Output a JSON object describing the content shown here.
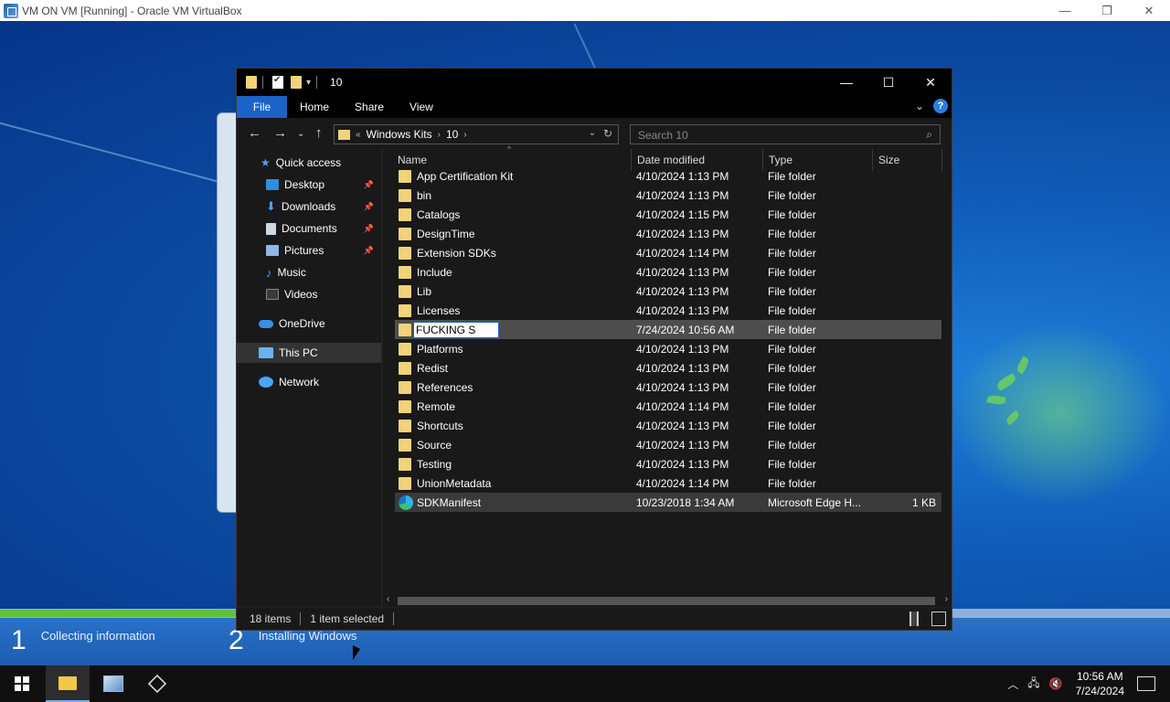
{
  "host": {
    "title": "VM ON VM [Running] - Oracle VM VirtualBox",
    "controls": [
      "—",
      "❐",
      "✕"
    ]
  },
  "setup": {
    "steps": [
      {
        "num": "1",
        "label": "Collecting information"
      },
      {
        "num": "2",
        "label": "Installing Windows"
      }
    ]
  },
  "explorer": {
    "title": "10",
    "controls": [
      "—",
      "☐",
      "✕"
    ],
    "ribbon": {
      "file": "File",
      "home": "Home",
      "share": "Share",
      "view": "View",
      "help": "?"
    },
    "address": {
      "prefix": "«",
      "crumbs": [
        "Windows Kits",
        "10"
      ]
    },
    "search_placeholder": "Search 10",
    "nav": {
      "quick_access": "Quick access",
      "desktop": "Desktop",
      "downloads": "Downloads",
      "documents": "Documents",
      "pictures": "Pictures",
      "music": "Music",
      "videos": "Videos",
      "onedrive": "OneDrive",
      "this_pc": "This PC",
      "network": "Network"
    },
    "columns": {
      "name": "Name",
      "date": "Date modified",
      "type": "Type",
      "size": "Size"
    },
    "rows": [
      {
        "name": "App Certification Kit",
        "date": "4/10/2024 1:13 PM",
        "type": "File folder",
        "size": ""
      },
      {
        "name": "bin",
        "date": "4/10/2024 1:13 PM",
        "type": "File folder",
        "size": ""
      },
      {
        "name": "Catalogs",
        "date": "4/10/2024 1:15 PM",
        "type": "File folder",
        "size": ""
      },
      {
        "name": "DesignTime",
        "date": "4/10/2024 1:13 PM",
        "type": "File folder",
        "size": ""
      },
      {
        "name": "Extension SDKs",
        "date": "4/10/2024 1:14 PM",
        "type": "File folder",
        "size": ""
      },
      {
        "name": "Include",
        "date": "4/10/2024 1:13 PM",
        "type": "File folder",
        "size": ""
      },
      {
        "name": "Lib",
        "date": "4/10/2024 1:13 PM",
        "type": "File folder",
        "size": ""
      },
      {
        "name": "Licenses",
        "date": "4/10/2024 1:13 PM",
        "type": "File folder",
        "size": ""
      },
      {
        "name": "FUCKING S",
        "date": "7/24/2024 10:56 AM",
        "type": "File folder",
        "size": ""
      },
      {
        "name": "Platforms",
        "date": "4/10/2024 1:13 PM",
        "type": "File folder",
        "size": ""
      },
      {
        "name": "Redist",
        "date": "4/10/2024 1:13 PM",
        "type": "File folder",
        "size": ""
      },
      {
        "name": "References",
        "date": "4/10/2024 1:13 PM",
        "type": "File folder",
        "size": ""
      },
      {
        "name": "Remote",
        "date": "4/10/2024 1:14 PM",
        "type": "File folder",
        "size": ""
      },
      {
        "name": "Shortcuts",
        "date": "4/10/2024 1:13 PM",
        "type": "File folder",
        "size": ""
      },
      {
        "name": "Source",
        "date": "4/10/2024 1:13 PM",
        "type": "File folder",
        "size": ""
      },
      {
        "name": "Testing",
        "date": "4/10/2024 1:13 PM",
        "type": "File folder",
        "size": ""
      },
      {
        "name": "UnionMetadata",
        "date": "4/10/2024 1:14 PM",
        "type": "File folder",
        "size": ""
      },
      {
        "name": "SDKManifest",
        "date": "10/23/2018 1:34 AM",
        "type": "Microsoft Edge H...",
        "size": "1 KB"
      }
    ],
    "status": {
      "items": "18 items",
      "selected": "1 item selected"
    }
  },
  "taskbar": {
    "time": "10:56 AM",
    "date": "7/24/2024"
  },
  "colors": {
    "accent": "#1a63c8",
    "folder": "#f2d27a",
    "progress": "#5fc23a"
  }
}
